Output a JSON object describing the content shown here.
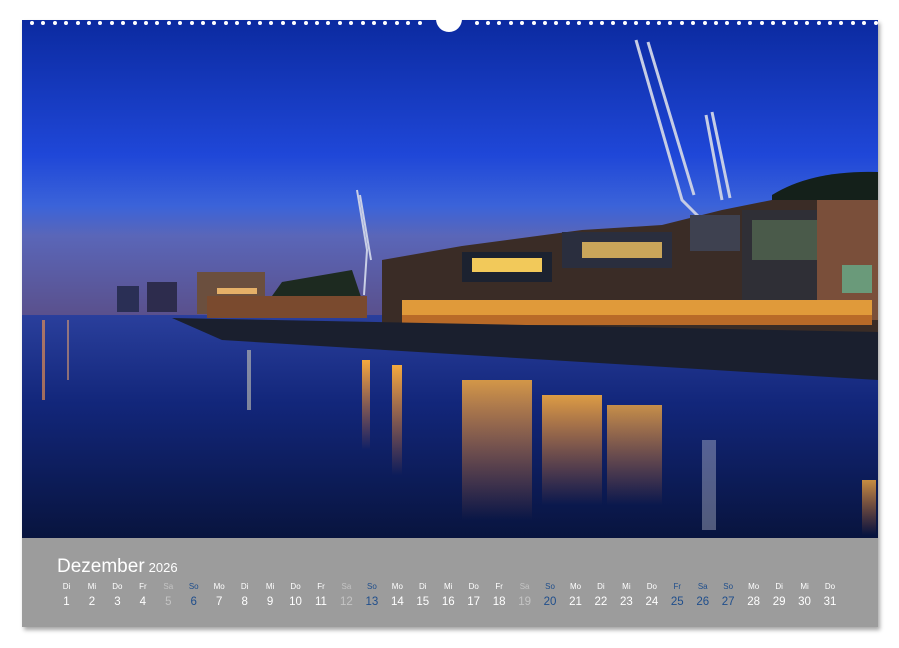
{
  "calendar": {
    "month": "Dezember",
    "year": "2026",
    "days": [
      {
        "dn": "Di",
        "dd": "1",
        "kind": "wd"
      },
      {
        "dn": "Mi",
        "dd": "2",
        "kind": "wd"
      },
      {
        "dn": "Do",
        "dd": "3",
        "kind": "wd"
      },
      {
        "dn": "Fr",
        "dd": "4",
        "kind": "wd"
      },
      {
        "dn": "Sa",
        "dd": "5",
        "kind": "sat"
      },
      {
        "dn": "So",
        "dd": "6",
        "kind": "sun"
      },
      {
        "dn": "Mo",
        "dd": "7",
        "kind": "wd"
      },
      {
        "dn": "Di",
        "dd": "8",
        "kind": "wd"
      },
      {
        "dn": "Mi",
        "dd": "9",
        "kind": "wd"
      },
      {
        "dn": "Do",
        "dd": "10",
        "kind": "wd"
      },
      {
        "dn": "Fr",
        "dd": "11",
        "kind": "wd"
      },
      {
        "dn": "Sa",
        "dd": "12",
        "kind": "sat"
      },
      {
        "dn": "So",
        "dd": "13",
        "kind": "sun"
      },
      {
        "dn": "Mo",
        "dd": "14",
        "kind": "wd"
      },
      {
        "dn": "Di",
        "dd": "15",
        "kind": "wd"
      },
      {
        "dn": "Mi",
        "dd": "16",
        "kind": "wd"
      },
      {
        "dn": "Do",
        "dd": "17",
        "kind": "wd"
      },
      {
        "dn": "Fr",
        "dd": "18",
        "kind": "wd"
      },
      {
        "dn": "Sa",
        "dd": "19",
        "kind": "sat"
      },
      {
        "dn": "So",
        "dd": "20",
        "kind": "sun"
      },
      {
        "dn": "Mo",
        "dd": "21",
        "kind": "wd"
      },
      {
        "dn": "Di",
        "dd": "22",
        "kind": "wd"
      },
      {
        "dn": "Mi",
        "dd": "23",
        "kind": "wd"
      },
      {
        "dn": "Do",
        "dd": "24",
        "kind": "wd"
      },
      {
        "dn": "Fr",
        "dd": "25",
        "kind": "hol"
      },
      {
        "dn": "Sa",
        "dd": "26",
        "kind": "hol"
      },
      {
        "dn": "So",
        "dd": "27",
        "kind": "sun"
      },
      {
        "dn": "Mo",
        "dd": "28",
        "kind": "wd"
      },
      {
        "dn": "Di",
        "dd": "29",
        "kind": "wd"
      },
      {
        "dn": "Mi",
        "dd": "30",
        "kind": "wd"
      },
      {
        "dn": "Do",
        "dd": "31",
        "kind": "wd"
      }
    ]
  },
  "colors": {
    "sky_top": "#0a2a9c",
    "sky_horizon": "#3a5fd6",
    "water": "#0d1f5a",
    "calendar_band": "#9c9c9c",
    "sunday_blue": "#1f4e8c"
  }
}
